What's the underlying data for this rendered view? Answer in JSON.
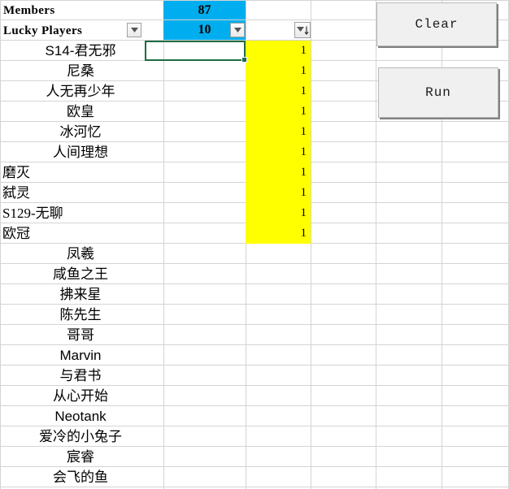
{
  "app": {
    "type": "spreadsheet",
    "title": "Members lucky-draw sheet"
  },
  "colors": {
    "accent_cyan": "#00AEEF",
    "highlight_yellow": "#FFFF00",
    "selection_green": "#1E6B43",
    "gridline": "#D4D4D4",
    "button_face": "#F0F0F0"
  },
  "header": {
    "rows": [
      {
        "label": "Members",
        "value": "87",
        "value_bg": "#00AEEF"
      },
      {
        "label": "Lucky Players",
        "value": "10",
        "value_bg": "#00AEEF"
      }
    ]
  },
  "filters": [
    {
      "name": "name-column-filter",
      "state": "none",
      "icon": "chevron-down-icon"
    },
    {
      "name": "count-column-filter",
      "state": "none",
      "icon": "chevron-down-icon"
    },
    {
      "name": "result-column-filter",
      "state": "sorted",
      "icon": "filter-sort-descending-icon"
    }
  ],
  "buttons": [
    {
      "name": "clear-button",
      "label": "Clear"
    },
    {
      "name": "run-button",
      "label": "Run"
    }
  ],
  "active_cell": {
    "value": "",
    "has_fill_handle": true
  },
  "table": {
    "name_column_values": [
      {
        "text": "S14-君无邪",
        "align": "center"
      },
      {
        "text": "尼桑",
        "align": "center"
      },
      {
        "text": "人无再少年",
        "align": "center"
      },
      {
        "text": "欧皇",
        "align": "center"
      },
      {
        "text": "冰河忆",
        "align": "center"
      },
      {
        "text": "人间理想",
        "align": "center"
      },
      {
        "text": "磨灭",
        "align": "left"
      },
      {
        "text": "弑灵",
        "align": "left"
      },
      {
        "text": "S129-无聊",
        "align": "left"
      },
      {
        "text": "欧冠",
        "align": "left"
      },
      {
        "text": "凤羲",
        "align": "center"
      },
      {
        "text": "咸鱼之王",
        "align": "center"
      },
      {
        "text": "拂来星",
        "align": "center"
      },
      {
        "text": "陈先生",
        "align": "center"
      },
      {
        "text": "哥哥",
        "align": "center"
      },
      {
        "text": "Marvin",
        "align": "center"
      },
      {
        "text": "与君书",
        "align": "center"
      },
      {
        "text": "从心开始",
        "align": "center"
      },
      {
        "text": "Neotank",
        "align": "center"
      },
      {
        "text": "爱冷的小兔子",
        "align": "center"
      },
      {
        "text": "宸睿",
        "align": "center"
      },
      {
        "text": "会飞的鱼",
        "align": "center"
      }
    ],
    "result_column_values": [
      "1",
      "1",
      "1",
      "1",
      "1",
      "1",
      "1",
      "1",
      "1",
      "1"
    ],
    "result_column_highlight": "#FFFF00"
  }
}
